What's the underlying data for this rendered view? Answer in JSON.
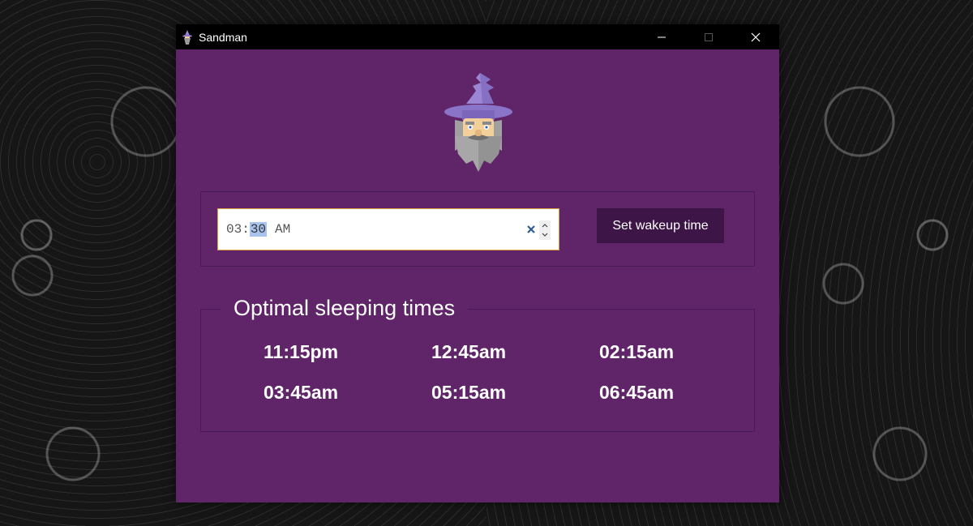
{
  "window": {
    "title": "Sandman",
    "icon": "wizard-icon",
    "controls": [
      "minimize-icon",
      "maximize-icon",
      "close-icon"
    ]
  },
  "mascot": {
    "icon": "wizard-mascot"
  },
  "wakeup": {
    "hours": "03",
    "separator": ":",
    "minutes": "30",
    "period": "AM",
    "button_label": "Set wakeup time"
  },
  "results": {
    "heading": "Optimal sleeping times",
    "times": [
      "11:15pm",
      "12:45am",
      "02:15am",
      "03:45am",
      "05:15am",
      "06:45am"
    ]
  },
  "colors": {
    "window_bg": "#602468",
    "button_bg": "#3d1547",
    "titlebar_bg": "#000000"
  }
}
